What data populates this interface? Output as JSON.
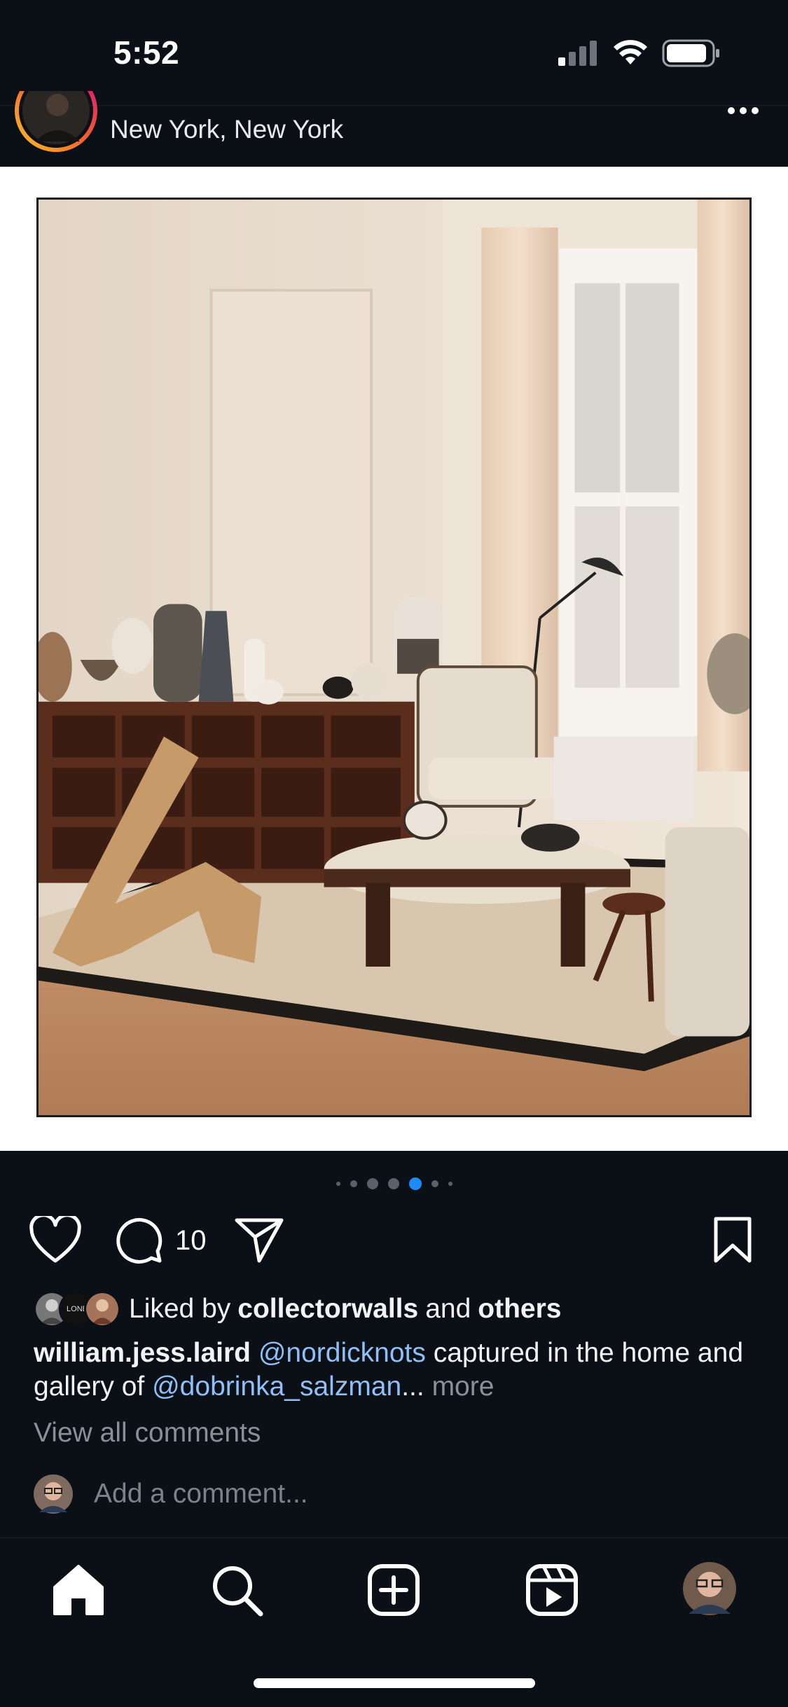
{
  "status_bar": {
    "time": "5:52"
  },
  "post": {
    "location": "New York, New York",
    "carousel": {
      "total_dots": 7,
      "active_index": 4
    },
    "actions": {
      "comment_count": "10"
    },
    "likes": {
      "prefix": "Liked by",
      "user": "collectorwalls",
      "and": "and",
      "others": "others",
      "avatar_label": "LONE"
    },
    "caption": {
      "author": "william.jess.laird",
      "mention1": "@nordicknots",
      "text1": " captured in the home and gallery of ",
      "mention2": "@dobrinka_salzman",
      "ellipsis": "...",
      "more": "more"
    },
    "view_all_comments": "View all comments",
    "add_comment_placeholder": "Add a comment..."
  },
  "tabbar": {
    "items": [
      "home-icon",
      "search-icon",
      "create-icon",
      "reels-icon",
      "profile-avatar"
    ]
  },
  "colors": {
    "background": "#0b0f16",
    "accent_dot": "#1d8cf8",
    "mention": "#8fbff7"
  }
}
